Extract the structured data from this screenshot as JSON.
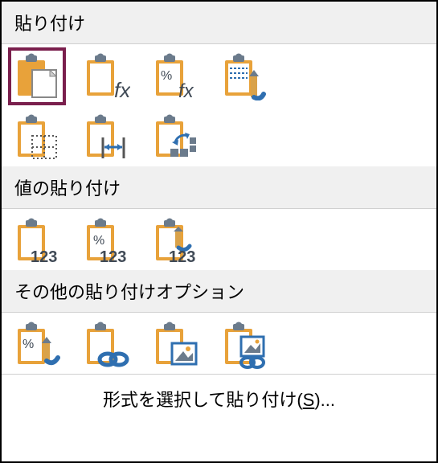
{
  "sections": {
    "paste": {
      "title": "貼り付け"
    },
    "values": {
      "title": "値の貼り付け"
    },
    "other": {
      "title": "その他の貼り付けオプション"
    }
  },
  "footer": {
    "prefix": "形式を選択して貼り付け(",
    "key": "S",
    "suffix": ")..."
  },
  "icons": {
    "paste": "paste",
    "pasteFx": "paste-formulas",
    "pastePctFx": "paste-formulas-number-fmt",
    "pasteKeepFmt": "paste-keep-source-fmt",
    "pasteNoBorder": "paste-no-borders",
    "pasteColWidth": "paste-keep-col-width",
    "pasteTranspose": "paste-transpose",
    "pasteValues": "paste-values",
    "pasteValuesPct": "paste-values-number-fmt",
    "pasteValuesFmt": "paste-values-source-fmt",
    "pasteFormatting": "paste-formatting",
    "pasteLink": "paste-link",
    "pastePicture": "paste-picture",
    "pastePictureLink": "paste-linked-picture"
  },
  "glyph": {
    "fx": "fx",
    "pct": "%",
    "n123": "123",
    "pctfx": "%fx"
  },
  "colors": {
    "board": "#e8a23a",
    "clip": "#6b7b8c",
    "paper": "#ffffff",
    "paperLine": "#b0b0b0",
    "accent": "#2f6fb0",
    "selected": "#7a1f4d"
  }
}
